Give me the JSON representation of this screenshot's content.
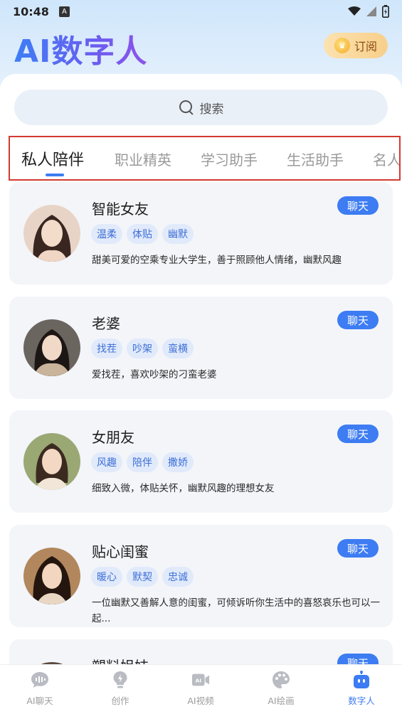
{
  "status_bar": {
    "time": "10:48",
    "notif_glyph": "A"
  },
  "header": {
    "app_title": "AI数字人",
    "subscribe_label": "订阅"
  },
  "search": {
    "placeholder": "搜索"
  },
  "tabs": [
    {
      "label": "私人陪伴",
      "active": true
    },
    {
      "label": "职业精英",
      "active": false
    },
    {
      "label": "学习助手",
      "active": false
    },
    {
      "label": "生活助手",
      "active": false
    },
    {
      "label": "名人",
      "active": false
    }
  ],
  "cards": [
    {
      "name": "智能女友",
      "chat_label": "聊天",
      "tags": [
        "温柔",
        "体贴",
        "幽默"
      ],
      "description": "甜美可爱的空乘专业大学生，善于照顾他人情绪，幽默风趣"
    },
    {
      "name": "老婆",
      "chat_label": "聊天",
      "tags": [
        "找茬",
        "吵架",
        "蛮横"
      ],
      "description": "爱找茬，喜欢吵架的刁蛮老婆"
    },
    {
      "name": "女朋友",
      "chat_label": "聊天",
      "tags": [
        "风趣",
        "陪伴",
        "撒娇"
      ],
      "description": "细致入微，体贴关怀，幽默风趣的理想女友"
    },
    {
      "name": "贴心闺蜜",
      "chat_label": "聊天",
      "tags": [
        "暖心",
        "默契",
        "忠诚"
      ],
      "description": "一位幽默又善解人意的闺蜜，可倾诉听你生活中的喜怒哀乐也可以一起..."
    },
    {
      "name": "塑料姐妹",
      "chat_label": "聊天",
      "tags": [],
      "description": ""
    }
  ],
  "bottom_nav": [
    {
      "label": "AI聊天",
      "icon": "chat-bubble-icon",
      "active": false
    },
    {
      "label": "创作",
      "icon": "lightbulb-icon",
      "active": false
    },
    {
      "label": "AI视频",
      "icon": "video-camera-icon",
      "active": false
    },
    {
      "label": "AI绘画",
      "icon": "palette-icon",
      "active": false
    },
    {
      "label": "数字人",
      "icon": "robot-icon",
      "active": true
    }
  ],
  "colors": {
    "accent": "#3d7cf2",
    "tab_highlight_border": "#d23a2f",
    "subscribe_gold": "#f8cf8b"
  }
}
